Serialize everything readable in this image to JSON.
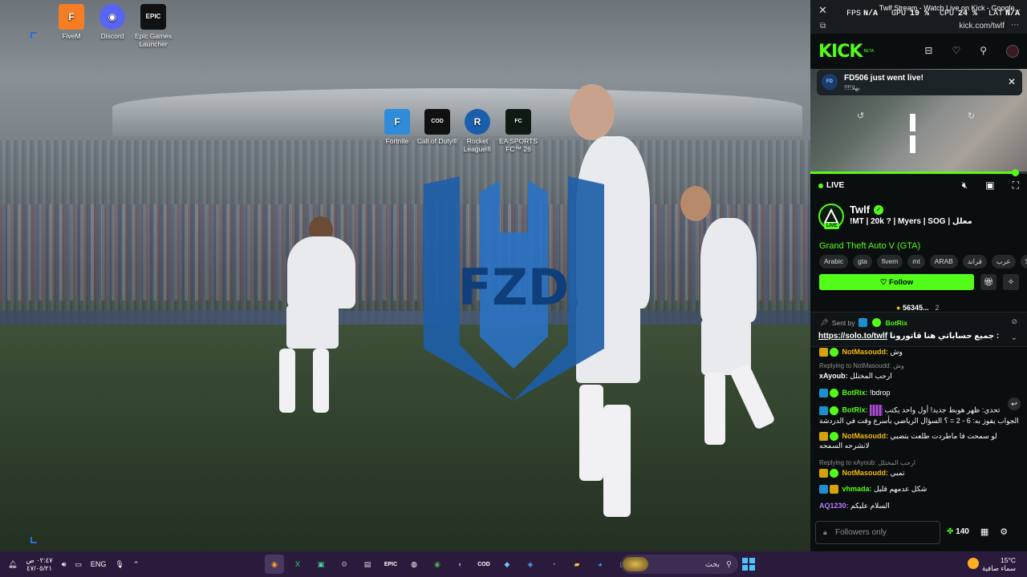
{
  "desktop": {
    "top_icons": [
      {
        "label": "FiveM",
        "icon": "fivem-icon",
        "color": "#f57d24"
      },
      {
        "label": "Discord",
        "icon": "discord-icon",
        "color": "#5865f2"
      },
      {
        "label": "Epic Games Launcher",
        "icon": "epic-games-icon",
        "color": "#111111"
      }
    ],
    "game_icons": [
      {
        "label": "Fortnite",
        "icon": "fortnite-icon",
        "color": "#2f8cd8"
      },
      {
        "label": "Call of Duty®",
        "icon": "call-of-duty-icon",
        "color": "#111111"
      },
      {
        "label": "Rocket League®",
        "icon": "rocket-league-icon",
        "color": "#1a5fae"
      },
      {
        "label": "EA SPORTS FC™ 26",
        "icon": "ea-sports-fc-icon",
        "color": "#0f1a14"
      }
    ],
    "wallpaper_logo_text": "FZD"
  },
  "titlebar": {
    "title": "Twlf Stream - Watch Live on Kick - Google...",
    "url": "kick.com/twlf"
  },
  "overlay": {
    "fps_label": "FPS",
    "fps_value": "N/A",
    "gpu_label": "GPU",
    "gpu_value": "19 %",
    "cpu_label": "CPU",
    "cpu_value": "24 %",
    "lat_label": "LAT",
    "lat_value": "N/A"
  },
  "kick": {
    "logo": "KICK",
    "beta": "BETA",
    "notification": {
      "title": "FD506 just went live!",
      "subtitle": "!!!!يهلا",
      "avatar": "FD"
    },
    "live_label": "LIVE",
    "progress_fraction": 0.96,
    "channel": {
      "name": "Twlf",
      "live_tag": "LIVE",
      "title": "!MT | 20k ? | Myers | SOG | معلل",
      "category": "Grand Theft Auto V (GTA)",
      "tags": [
        "Arabic",
        "gta",
        "fivem",
        "mt",
        "ARAB",
        "قراند",
        "عرب",
        "So"
      ],
      "follow_label": "Follow",
      "viewers": "56345...",
      "viewers_extra": "2"
    },
    "pinned": {
      "sent_by_label": "Sent by",
      "sender": "BotRix",
      "text": "جميع حساباتي هنا قاتورونا :",
      "link": "https://solo.to/twlf"
    },
    "chat": [
      {
        "reply": "",
        "user": "NotMasoudd:",
        "user_color": "#f5b80c",
        "text": "وش"
      },
      {
        "reply": "Replying to NotMasoudd: وش",
        "user": "xAyoub:",
        "user_color": "#ffffff",
        "text": "ارحب المختلل"
      },
      {
        "reply": "",
        "user": "BotRix:",
        "user_color": "#53fc18",
        "text": "!bdrop"
      },
      {
        "reply": "",
        "user": "BotRix:",
        "user_color": "#53fc18",
        "text": "تحدي: ظهر هوبط جديد! أول واحد يكتب الجواب يفوز به: 6 - 2 = ؟ السؤال الرياضي بأسرع وقت في الدردشة"
      },
      {
        "reply": "",
        "user": "NotMasoudd:",
        "user_color": "#f5b80c",
        "text": "لو سمحت قا ماطردت طلعت بتضبي لانشرحه السمحه"
      },
      {
        "reply": "Replying to xAyoub: ارحب المختلل",
        "user": "NotMasoudd:",
        "user_color": "#f5b80c",
        "text": "تمبي"
      },
      {
        "reply": "",
        "user": "vhmada:",
        "user_color": "#53fc18",
        "text": "شكل عدمهم قليل"
      },
      {
        "reply": "",
        "user": "AQ1230:",
        "user_color": "#b47cff",
        "text": "السلام عليكم"
      }
    ],
    "chat_input_placeholder": "Followers only",
    "points": "140"
  },
  "taskbar": {
    "time": "٠٢:٤٧ ص",
    "date": "٤٧/٠٥/٢١",
    "lang": "ENG",
    "search_placeholder": "بحث",
    "weather_temp": "15°C",
    "weather_text": "سماء صافية",
    "apps": [
      "chrome-orange-icon",
      "excel-icon",
      "screenshot-icon",
      "settings-icon",
      "store-icon",
      "epic-games-icon",
      "gta-icon",
      "chrome-icon",
      "discord-icon",
      "call-of-duty-icon",
      "fivem-icon",
      "rocket-league-icon",
      "edge-icon",
      "file-explorer-icon",
      "edge-blue-icon",
      "files-icon"
    ]
  }
}
